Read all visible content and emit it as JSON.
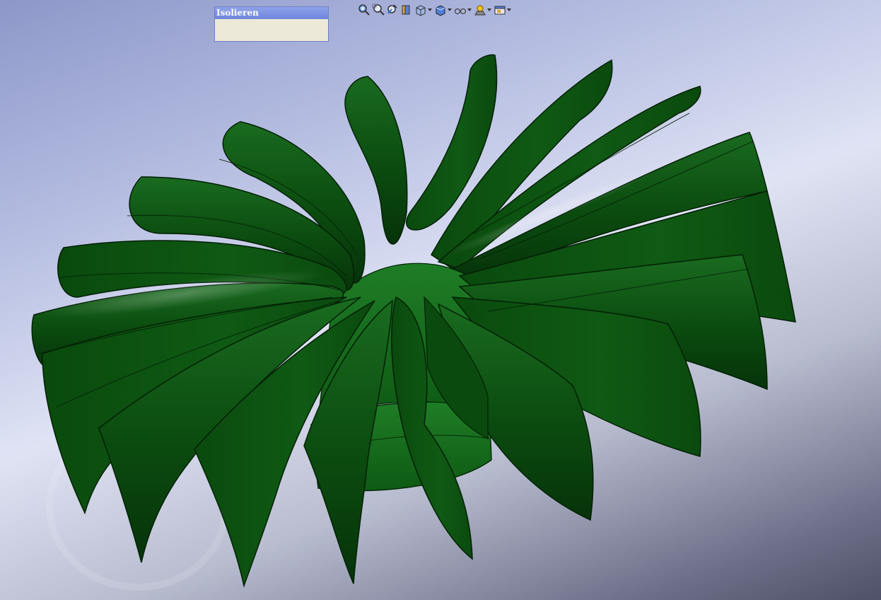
{
  "isolate_panel": {
    "title": "Isolieren"
  },
  "toolbar": {
    "items": [
      {
        "icon": "zoom-to-fit-icon",
        "has_dropdown": false
      },
      {
        "icon": "zoom-to-area-icon",
        "has_dropdown": false
      },
      {
        "icon": "previous-view-icon",
        "has_dropdown": false
      },
      {
        "icon": "section-view-icon",
        "has_dropdown": false
      },
      {
        "icon": "view-orientation-icon",
        "has_dropdown": true
      },
      {
        "icon": "display-style-icon",
        "has_dropdown": true
      },
      {
        "icon": "hide-show-items-icon",
        "has_dropdown": true
      },
      {
        "icon": "edit-appearance-icon",
        "has_dropdown": true
      },
      {
        "icon": "view-settings-icon",
        "has_dropdown": true
      }
    ]
  },
  "model": {
    "color": "#0e5a14",
    "dark_color": "#083a0b",
    "highlight_color": "#2f8a35"
  }
}
